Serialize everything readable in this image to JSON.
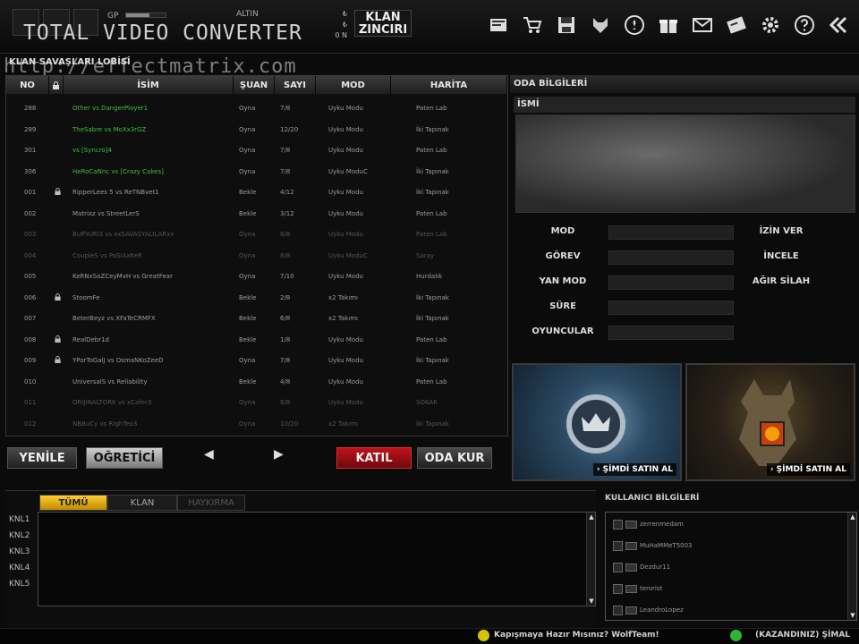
{
  "topbar": {
    "gp_label": "GP",
    "gp_progress": 0.6,
    "altin_label": "ALTIN",
    "watermark": "TOTAL VIDEO CONVERTER",
    "klan_mini": [
      "₺",
      "₺",
      "0 N"
    ],
    "klan_zinciri": "KLAN ZINCIRI",
    "icons": [
      "document-icon",
      "cart-icon",
      "save-icon",
      "wolf-icon",
      "emblem-icon",
      "gift-icon",
      "mail-icon",
      "card-icon",
      "gear-icon",
      "help-icon",
      "back-icon"
    ]
  },
  "lobby": {
    "title": "KLAN SAVAŞLARI LOBİSİ",
    "watermark_url": "http://effectmatrix.com",
    "columns": [
      "NO",
      "",
      "İSİM",
      "ŞUAN",
      "SAYI",
      "MOD",
      "HARİTA"
    ],
    "rows": [
      {
        "no": "288",
        "lock": false,
        "name": "Other vs DangerPlayer1",
        "status": "Oyna",
        "count": "7/8",
        "mode": "Uyku Modu",
        "map": "Paten Lab",
        "style": "green"
      },
      {
        "no": "289",
        "lock": false,
        "name": "TheSabre vs MoXx3rGZ",
        "status": "Oyna",
        "count": "12/20",
        "mode": "Uyku Modu",
        "map": "İki Tapınak",
        "style": "green"
      },
      {
        "no": "301",
        "lock": false,
        "name": "vs [Syncro]4",
        "status": "Oyna",
        "count": "7/8",
        "mode": "Uyku Modu",
        "map": "Paten Lab",
        "style": "green"
      },
      {
        "no": "306",
        "lock": false,
        "name": "HeRoCaNnc vs [Crazy Cakes]",
        "status": "Oyna",
        "count": "7/8",
        "mode": "Uyku ModuC",
        "map": "İki Tapınak",
        "style": "green"
      },
      {
        "no": "001",
        "lock": true,
        "name": "RipperLees 5 vs ReTNBvet1",
        "status": "Bekle",
        "count": "4/12",
        "mode": "Uyku Modu",
        "map": "İki Tapınak",
        "style": "normal"
      },
      {
        "no": "002",
        "lock": false,
        "name": "Matrixz vs StreetLerS",
        "status": "Bekle",
        "count": "3/12",
        "mode": "Uyku Modu",
        "map": "Paten Lab",
        "style": "normal"
      },
      {
        "no": "003",
        "lock": false,
        "name": "BuffYuRt3 vs xxSAVASYALILARxx",
        "status": "Oyna",
        "count": "8/8",
        "mode": "Uyku Modu",
        "map": "Paten Lab",
        "style": "dim"
      },
      {
        "no": "004",
        "lock": false,
        "name": "CoupleS vs PaSiAxKeR",
        "status": "Oyna",
        "count": "8/8",
        "mode": "Uyku ModuC",
        "map": "Saray",
        "style": "dim"
      },
      {
        "no": "005",
        "lock": false,
        "name": "KeRNxSoZCeyMvH vs GreatFear",
        "status": "Oyna",
        "count": "7/10",
        "mode": "Uyku Modu",
        "map": "Hurdalık",
        "style": "normal"
      },
      {
        "no": "006",
        "lock": true,
        "name": "StoomFe",
        "status": "Bekle",
        "count": "2/8",
        "mode": "x2 Takımı",
        "map": "İki Tapınak",
        "style": "normal"
      },
      {
        "no": "007",
        "lock": false,
        "name": "BeterBeyz vs XFaTeCRMFX",
        "status": "Bekle",
        "count": "6/8",
        "mode": "x2 Takımı",
        "map": "İki Tapınak",
        "style": "normal"
      },
      {
        "no": "008",
        "lock": true,
        "name": "RealDebr1d",
        "status": "Bekle",
        "count": "1/8",
        "mode": "Uyku Modu",
        "map": "Paten Lab",
        "style": "normal"
      },
      {
        "no": "009",
        "lock": true,
        "name": "YPorToGalJ vs OsmaNKoZeeD",
        "status": "Oyna",
        "count": "7/8",
        "mode": "Uyku Modu",
        "map": "İki Tapınak",
        "style": "normal"
      },
      {
        "no": "010",
        "lock": false,
        "name": "UniversalS vs Reliability",
        "status": "Bekle",
        "count": "4/8",
        "mode": "Uyku Modu",
        "map": "Paten Lab",
        "style": "normal"
      },
      {
        "no": "011",
        "lock": false,
        "name": "ORIJINALTORK vs xCafer3",
        "status": "Oyna",
        "count": "8/8",
        "mode": "Uyku Modu",
        "map": "SOKAK",
        "style": "dim"
      },
      {
        "no": "012",
        "lock": false,
        "name": "NBBuCy vs RighTeo3",
        "status": "Oyna",
        "count": "10/20",
        "mode": "x2 Takımı",
        "map": "İki Tapınak",
        "style": "dim"
      }
    ]
  },
  "buttons": {
    "refresh": "YENİLE",
    "tutorial": "OĞRETİCİ",
    "prev": "◀",
    "next": "▶",
    "join": "KATIL",
    "create": "ODA KUR"
  },
  "room_info": {
    "header": "ODA BİLGİLERİ",
    "name_label": "İSMİ",
    "fields": [
      "MOD",
      "GÖREV",
      "YAN MOD",
      "SÜRE",
      "OYUNCULAR"
    ],
    "options": [
      "İZİN VER",
      "İNCELE",
      "AĞIR SİLAH"
    ],
    "promo1_cta": "› ŞİMDİ SATIN AL",
    "promo2_cta": "› ŞİMDİ SATIN AL"
  },
  "chat": {
    "tabs": [
      "TÜMÜ",
      "KLAN",
      "HAYKIRMA"
    ],
    "channels": [
      "KNL1",
      "KNL2",
      "KNL3",
      "KNL4",
      "KNL5"
    ]
  },
  "users": {
    "header": "KULLANICI BİLGİLERİ",
    "list": [
      "zerrenmedam",
      "MuHaMMeT5003",
      "Dezdur11",
      "terorist",
      "LeandroLopez"
    ]
  },
  "ticker": {
    "left": "Kapışmaya Hazır Mısınız? WolfTeam!",
    "right": "(KAZANDINIZ) ŞİMAL"
  },
  "colors": {
    "accent_red": "#c0121a",
    "accent_yellow": "#ffce2e",
    "row_green": "#3fbf3a"
  }
}
